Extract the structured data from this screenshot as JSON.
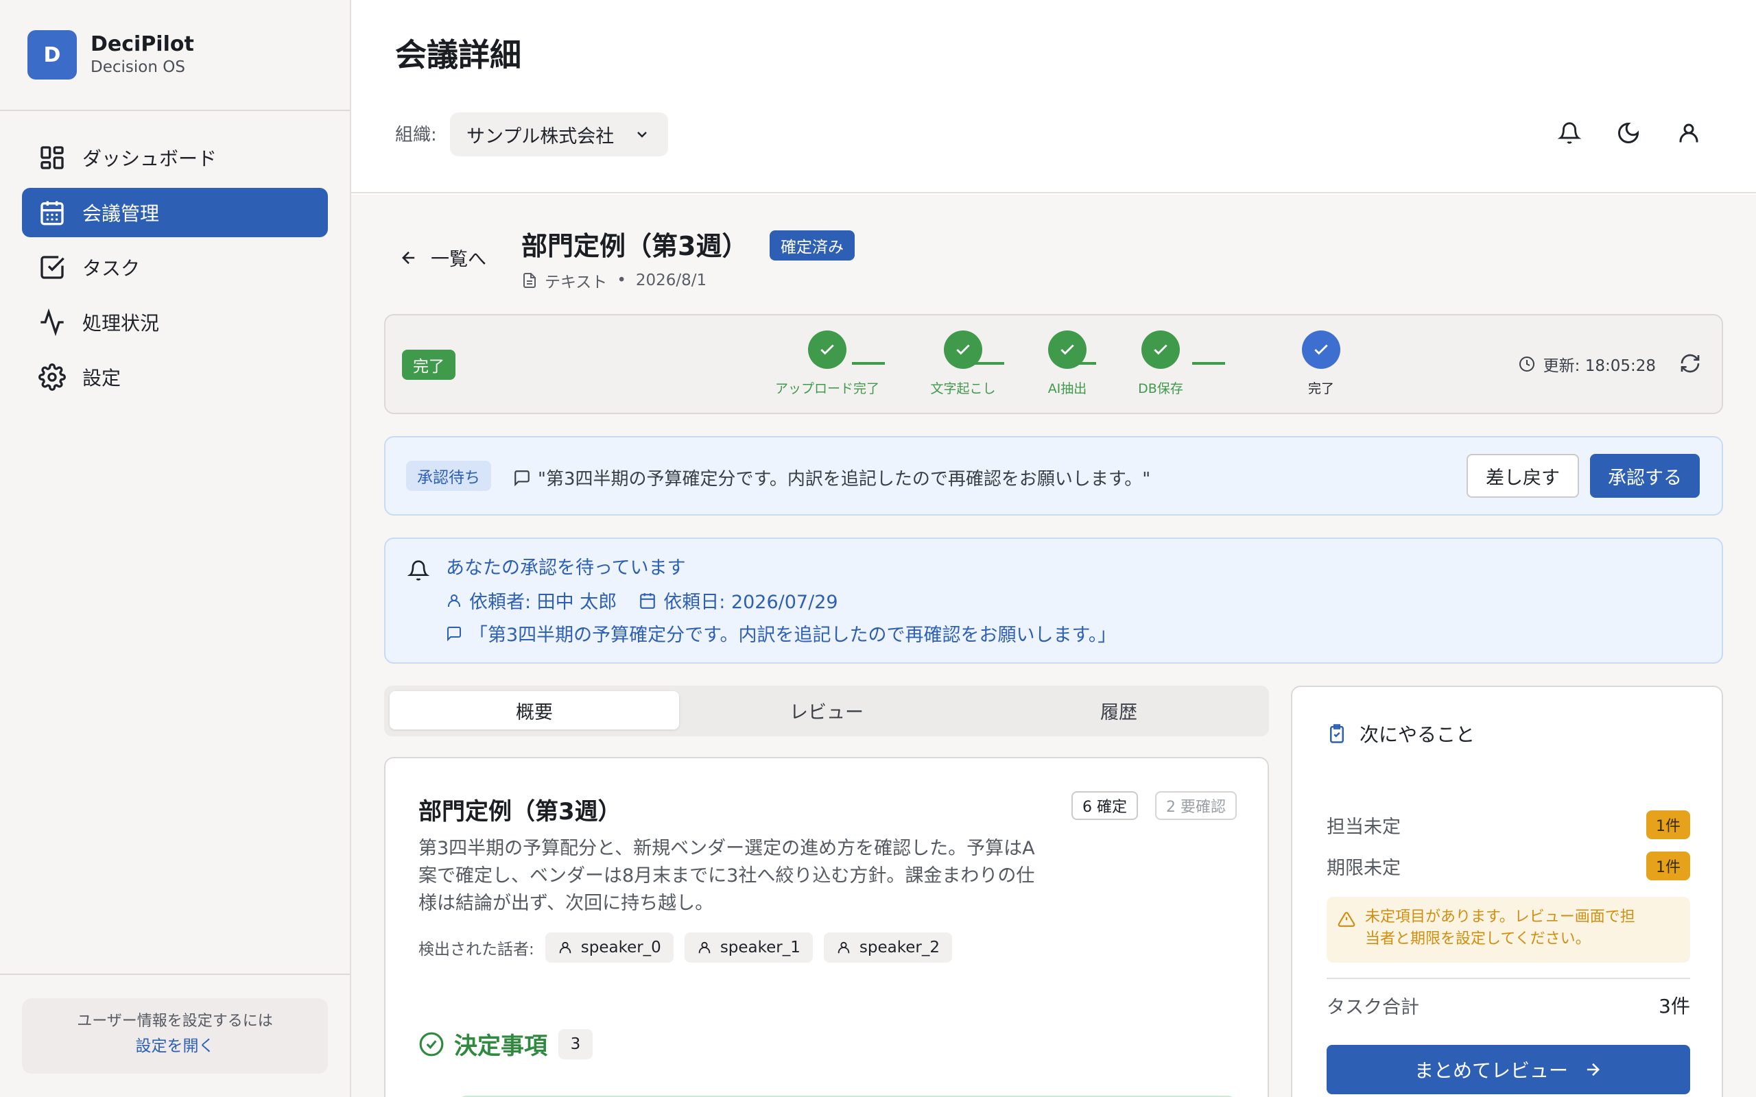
{
  "brand": {
    "logo_letter": "D",
    "name": "DeciPilot",
    "subtitle": "Decision OS"
  },
  "sidebar": {
    "items": [
      {
        "label": "ダッシュボード",
        "icon": "dashboard-grid-icon",
        "active": false
      },
      {
        "label": "会議管理",
        "icon": "calendar-icon",
        "active": true
      },
      {
        "label": "タスク",
        "icon": "checkbox-icon",
        "active": false
      },
      {
        "label": "処理状況",
        "icon": "activity-pulse-icon",
        "active": false
      },
      {
        "label": "設定",
        "icon": "gear-icon",
        "active": false
      }
    ],
    "user_hint": {
      "text": "ユーザー情報を設定するには",
      "link": "設定を開く"
    }
  },
  "header": {
    "title": "会議詳細",
    "org_label": "組織:",
    "org_value": "サンプル株式会社",
    "icons": [
      "bell-icon",
      "moon-icon",
      "user-icon"
    ]
  },
  "meeting": {
    "back_label": "一覧へ",
    "title": "部門定例（第3週）",
    "status": "確定済み",
    "source": "テキスト",
    "separator": "•",
    "date": "2026/8/1"
  },
  "progress": {
    "status_badge": "完了",
    "steps": [
      {
        "label": "アップロード完了"
      },
      {
        "label": "文字起こし"
      },
      {
        "label": "AI抽出"
      },
      {
        "label": "DB保存"
      },
      {
        "label": "完了"
      }
    ],
    "updated_label": "更新: 18:05:28"
  },
  "approval": {
    "badge": "承認待ち",
    "comment": "\"第3四半期の予算確定分です。内訳を追記したので再確認をお願いします。\"",
    "return_label": "差し戻す",
    "approve_label": "承認する"
  },
  "notice": {
    "title": "あなたの承認を待っています",
    "requester": "依頼者: 田中 太郎",
    "request_date": "依頼日: 2026/07/29",
    "comment": "「第3四半期の予算確定分です。内訳を追記したので再確認をお願いします。」"
  },
  "tabs": [
    {
      "label": "概要",
      "active": true
    },
    {
      "label": "レビュー",
      "active": false
    },
    {
      "label": "履歴",
      "active": false
    }
  ],
  "summary": {
    "title": "部門定例（第3週）",
    "confirmed_chip": "6 確定",
    "needs_review_chip": "2 要確認",
    "text_lines": [
      "第3四半期の予算配分と、新規ベンダー選定の進め方を確認した。予算はA",
      "案で確定し、ベンダーは8月末までに3社へ絞り込む方針。課金まわりの仕",
      "様は結論が出ず、次回に持ち越し。"
    ],
    "speakers_label": "検出された話者:",
    "speakers": [
      "speaker_0",
      "speaker_1",
      "speaker_2"
    ],
    "decisions_label": "決定事項",
    "decisions_count": "3"
  },
  "next_actions": {
    "title": "次にやること",
    "unassigned_label": "担当未定",
    "unassigned_value": "1件",
    "no_deadline_label": "期限未定",
    "no_deadline_value": "1件",
    "warning_lines": [
      "未定項目があります。レビュー画面で担",
      "当者と期限を設定してください。"
    ],
    "total_label": "タスク合計",
    "total_value": "3件",
    "review_button": "まとめてレビュー"
  },
  "colors": {
    "primary": "#2d5fb5",
    "success": "#3f9a4b",
    "warning": "#e6a21a",
    "info_bg": "#eef4fd"
  }
}
